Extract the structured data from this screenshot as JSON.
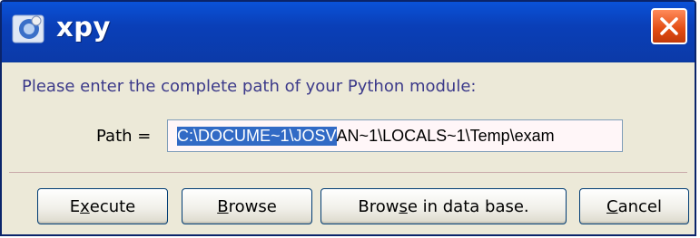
{
  "window": {
    "title": "xpy"
  },
  "prompt": "Please enter the complete path of your Python module:",
  "path": {
    "label": "Path =",
    "value_selected": "C:\\DOCUME~1\\JOSV",
    "value_rest": "AN~1\\LOCALS~1\\Temp\\exam"
  },
  "buttons": {
    "execute": {
      "pre": "E",
      "mnemonic": "x",
      "post": "ecute"
    },
    "browse": {
      "pre": "",
      "mnemonic": "B",
      "post": "rowse"
    },
    "browse_db": {
      "pre": "Brow",
      "mnemonic": "s",
      "post": "e in data base."
    },
    "cancel": {
      "pre": "",
      "mnemonic": "C",
      "post": "ancel"
    }
  },
  "icons": {
    "app": "python-app-icon",
    "close": "close-icon"
  },
  "colors": {
    "titlebar": "#0a46c8",
    "close": "#e24b12",
    "prompt_text": "#3c3a8a",
    "selection": "#316ac5",
    "dialog_bg": "#ece9d8"
  }
}
